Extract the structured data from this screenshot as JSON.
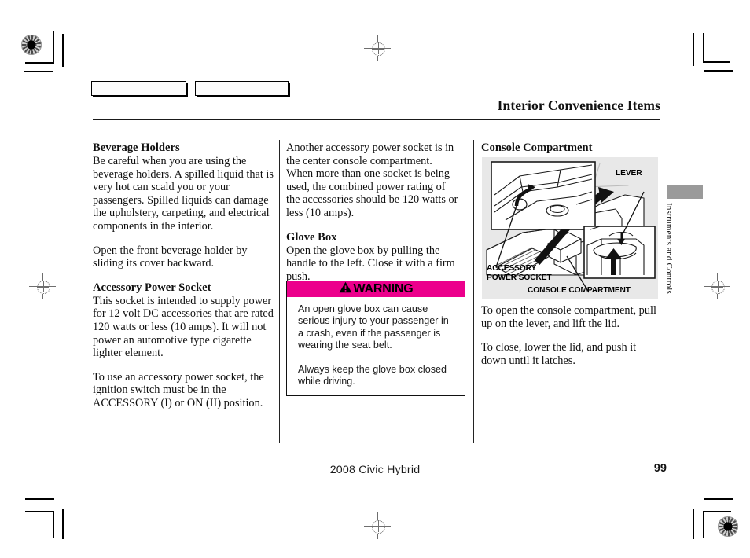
{
  "header": {
    "title": "Interior Convenience Items"
  },
  "columns": {
    "left": {
      "heading_1": "Beverage Holders",
      "body_1": "Be careful when you are using the beverage holders. A spilled liquid that is very hot can scald you or your passengers. Spilled liquids can damage the upholstery, carpeting, and electrical components in the interior.",
      "body_2": "Open the front beverage holder by sliding its cover backward.",
      "heading_2": "Accessory Power Socket",
      "body_3": "This socket is intended to supply power for 12 volt DC accessories that are rated 120 watts or less (10 amps). It will not power an automotive type cigarette lighter element.",
      "body_4": "To use an accessory power socket, the ignition switch must be in the ACCESSORY (I) or ON (II) position."
    },
    "middle": {
      "body_1": "Another accessory power socket is in the center console compartment. When more than one socket is being used, the combined power rating of the accessories should be 120 watts or less (10 amps).",
      "heading_1": "Glove Box",
      "body_2": "Open the glove box by pulling the handle to the left. Close it with a firm push."
    },
    "right": {
      "heading_1": "Console Compartment",
      "body_1": "To open the console compartment, pull up on the lever, and lift the lid.",
      "body_2": "To close, lower the lid, and push it down until it latches."
    }
  },
  "warning": {
    "title": "WARNING",
    "icon": "warning-triangle-icon",
    "header_color": "#ec008c",
    "paragraph_1": "An open glove box can cause serious injury to your passenger in a crash, even if the passenger is wearing the seat belt.",
    "paragraph_2": "Always keep the glove box closed while driving."
  },
  "illustration": {
    "name": "console-compartment-diagram",
    "background_color": "#e8e8e8",
    "callouts": {
      "lever": "LEVER",
      "accessory_power_socket": "ACCESSORY\nPOWER SOCKET",
      "console_compartment": "CONSOLE COMPARTMENT"
    }
  },
  "edge_tab": {
    "label": "Instruments and Controls",
    "color": "#9a9a9a"
  },
  "footer": {
    "model": "2008  Civic  Hybrid",
    "page_number": "99"
  }
}
